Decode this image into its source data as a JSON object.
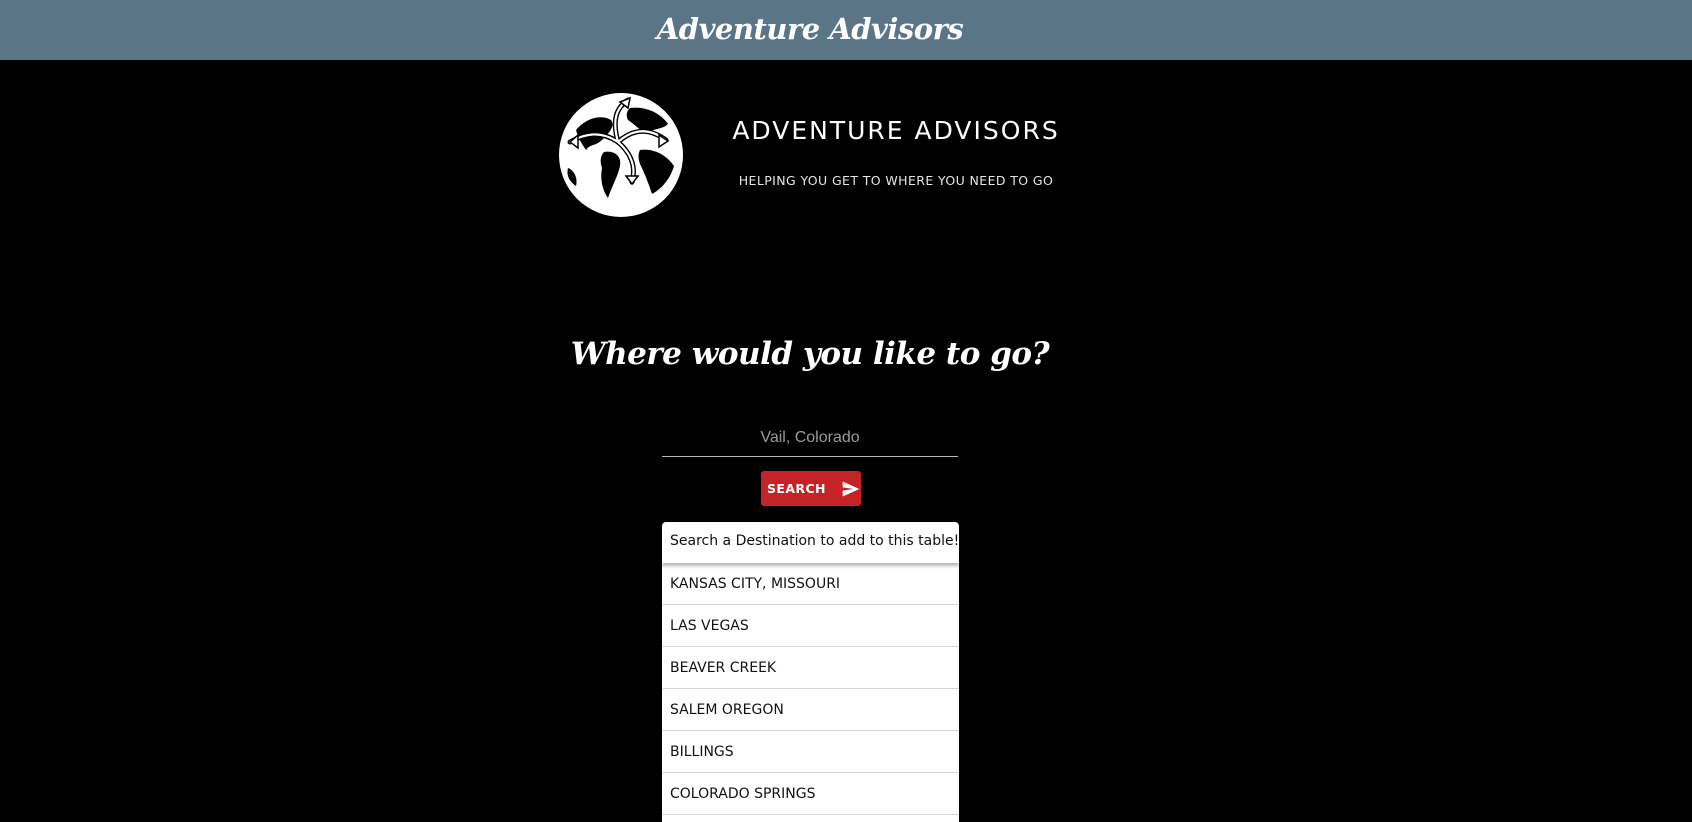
{
  "header": {
    "title": "Adventure Advisors"
  },
  "logo": {
    "name": "ADVENTURE ADVISORS",
    "tagline": "HELPING YOU GET TO WHERE YOU NEED TO GO",
    "icon": "globe-with-arrows-icon"
  },
  "main": {
    "heading": "Where would you like to go?"
  },
  "search": {
    "placeholder": "Vail, Colorado",
    "value": "",
    "button_label": "SEARCH",
    "button_icon": "send-icon",
    "button_color": "#c62328"
  },
  "table": {
    "header": "Search a Destination to add to this table!",
    "rows": [
      "KANSAS CITY, MISSOURI",
      "LAS VEGAS",
      "BEAVER CREEK",
      "SALEM OREGON",
      "BILLINGS",
      "COLORADO SPRINGS"
    ]
  },
  "colors": {
    "header_bar": "#5a7585",
    "background": "#000000",
    "accent": "#c62328"
  }
}
